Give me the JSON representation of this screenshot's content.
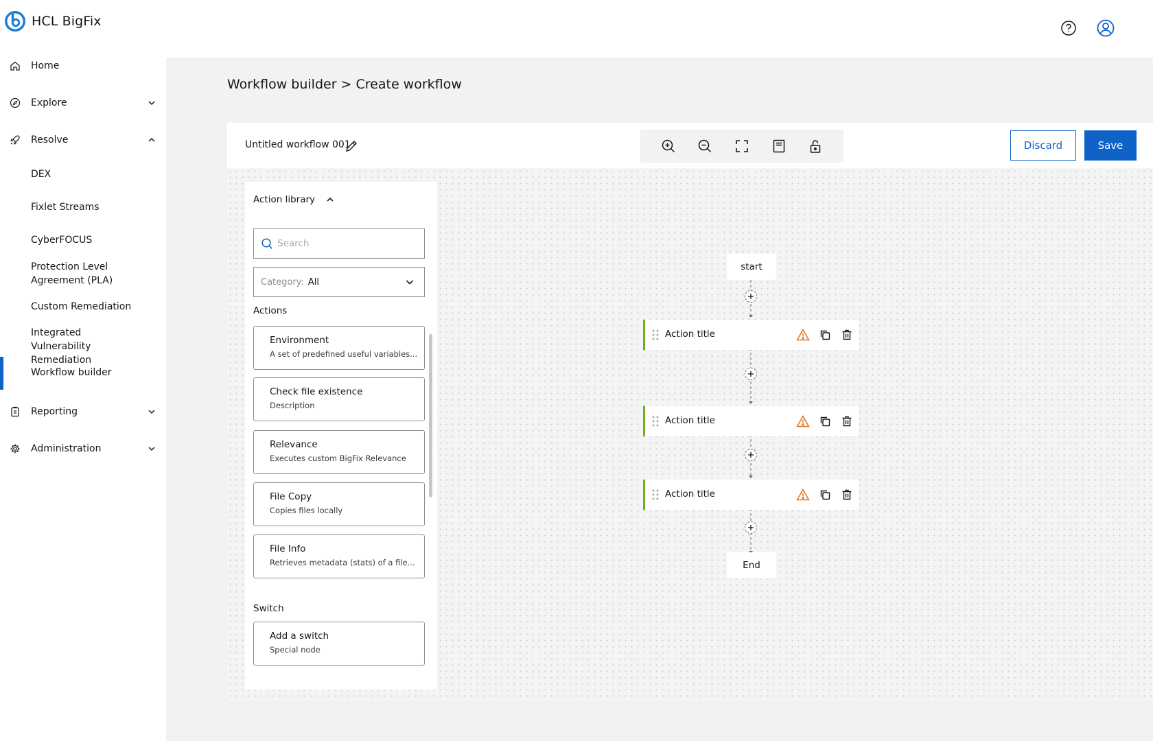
{
  "app": {
    "name": "HCL BigFix"
  },
  "header": {
    "icons": [
      "help-icon",
      "user-profile-icon"
    ]
  },
  "sidebar": {
    "items": [
      {
        "label": "Home",
        "icon": "home-icon"
      },
      {
        "label": "Explore",
        "icon": "compass-icon"
      },
      {
        "label": "Resolve",
        "icon": "rocket-icon"
      },
      {
        "label": "Reporting",
        "icon": "report-icon"
      },
      {
        "label": "Administration",
        "icon": "gear-icon"
      }
    ],
    "resolve_sub": [
      "DEX",
      "Fixlet Streams",
      "CyberFOCUS",
      "Protection Level Agreement (PLA)",
      "Custom Remediation",
      "Integrated Vulnerability Remediation",
      "Workflow builder"
    ],
    "active": "Workflow builder"
  },
  "page": {
    "breadcrumb": "Workflow builder > Create workflow"
  },
  "workflow": {
    "name": "Untitled workflow 001"
  },
  "toolbar": {
    "tools": [
      "zoom-in-icon",
      "zoom-out-icon",
      "fit-screen-icon",
      "minimap-icon",
      "unlock-icon"
    ]
  },
  "buttons": {
    "discard": "Discard",
    "save": "Save"
  },
  "library": {
    "title": "Action library",
    "search_placeholder": "Search",
    "category_label": "Category:",
    "category_value": "All",
    "actions_title": "Actions",
    "actions": [
      {
        "title": "Environment",
        "desc": "A set of predefined useful variables..."
      },
      {
        "title": "Check file existence",
        "desc": "Description"
      },
      {
        "title": "Relevance",
        "desc": "Executes custom BigFix Relevance"
      },
      {
        "title": "File Copy",
        "desc": "Copies files locally"
      },
      {
        "title": "File Info",
        "desc": "Retrieves metadata (stats) of a file..."
      }
    ],
    "switch_title": "Switch",
    "switch": {
      "title": "Add a switch",
      "desc": "Special node"
    }
  },
  "flow": {
    "start": "start",
    "end": "End",
    "nodes": [
      {
        "title": "Action title"
      },
      {
        "title": "Action title"
      },
      {
        "title": "Action title"
      }
    ]
  },
  "colors": {
    "accent": "#0f62c8",
    "node_border": "#6fac1e",
    "warning": "#da6a1e"
  }
}
